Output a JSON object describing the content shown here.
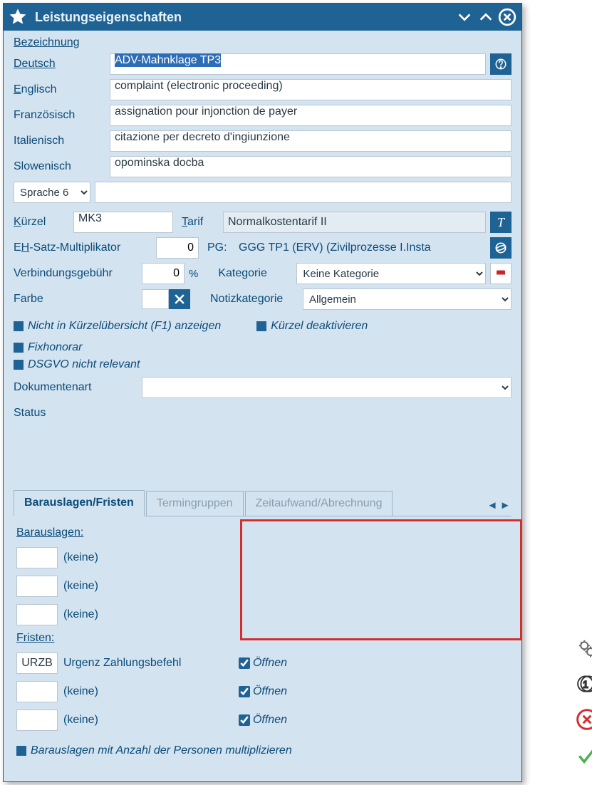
{
  "window": {
    "title": "Leistungseigenschaften"
  },
  "section_bezeichnung": "Bezeichnung",
  "languages": {
    "deutsch_label": "Deutsch",
    "deutsch_value": "ADV-Mahnklage TP3",
    "englisch_label": "Englisch",
    "englisch_value": "complaint (electronic proceeding)",
    "franzoesisch_label": "Französisch",
    "franzoesisch_value": "assignation pour injonction de payer",
    "italienisch_label": "Italienisch",
    "italienisch_value": "citazione per decreto d'ingiunzione",
    "slowenisch_label": "Slowenisch",
    "slowenisch_value": "opominska docba",
    "sprache6_label": "Sprache 6",
    "sprache6_value": ""
  },
  "kuerzel_label": "Kürzel",
  "kuerzel_value": "MK3",
  "tarif_label": "Tarif",
  "tarif_value": "Normalkostentarif II",
  "tarif_button": "T",
  "eh_label": "EH-Satz-Multiplikator",
  "eh_value": "0",
  "pg_label": "PG:",
  "pg_value": "GGG TP1 (ERV) (Zivilprozesse I.Insta",
  "verb_label": "Verbindungsgebühr",
  "verb_value": "0",
  "verb_unit": "%",
  "kategorie_label": "Kategorie",
  "kategorie_value": "Keine Kategorie",
  "farbe_label": "Farbe",
  "notizkat_label": "Notizkategorie",
  "notizkat_value": "Allgemein",
  "chk_nicht_anzeigen": "Nicht in Kürzelübersicht (F1) anzeigen",
  "chk_deaktivieren": "Kürzel deaktivieren",
  "chk_fixhonorar": "Fixhonorar",
  "chk_dsgvo": "DSGVO nicht relevant",
  "dokart_label": "Dokumentenart",
  "dokart_value": "",
  "status_label": "Status",
  "tabs": {
    "tab1": "Barauslagen/Fristen",
    "tab2": "Termingruppen",
    "tab3": "Zeitaufwand/Abrechnung"
  },
  "barauslagen_label": "Barauslagen:",
  "fristen_label": "Fristen:",
  "keine": "(keine)",
  "frist1_code": "URZB",
  "frist1_text": "Urgenz Zahlungsbefehl",
  "oeffnen": "Öffnen",
  "chk_baraus_mult": "Barauslagen mit Anzahl der Personen multiplizieren",
  "side_count_badge": "1"
}
